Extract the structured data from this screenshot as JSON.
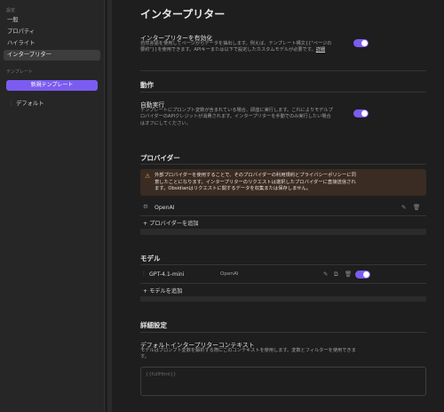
{
  "sidebar": {
    "settings_heading": "設定",
    "items": [
      {
        "label": "一般"
      },
      {
        "label": "プロパティ"
      },
      {
        "label": "ハイライト"
      },
      {
        "label": "インタープリター"
      }
    ],
    "templates_heading": "テンプレート",
    "new_template_label": "新規テンプレート",
    "template_items": [
      {
        "label": "デフォルト"
      }
    ]
  },
  "main": {
    "title": "インタープリター",
    "enable": {
      "name": "インタープリターを有効化",
      "desc_line1": "自然言語を使用してページからデータを抽出します。例えば、テンプレート構文{{\"ページの",
      "desc_line2": "要約\"}}を使用できます。APIキーまたは以下で設定したカスタムモデルが必要です。",
      "link": "詳細",
      "enabled": true
    },
    "behavior": {
      "title": "動作",
      "auto_run_name": "自動実行",
      "auto_run_desc_line1": "テンプレートにプロンプト変数が含まれている場合、即座に実行します。これによりモデルプ",
      "auto_run_desc_line2": "ロバイダーのAPIクレジットが消費されます。インタープリターを手動でのみ実行したい場合",
      "auto_run_desc_line3": "はオフにしてください。",
      "enabled": true
    },
    "providers": {
      "title": "プロバイダー",
      "warning_line1": "外部プロバイダーを使用することで、そのプロバイダーの利用規約とプライバシーポリシーに同",
      "warning_line2": "意したことになります。インタープリターのリクエストは選択したプロバイダーに直接送信され",
      "warning_line3": "ます。Obsidianはリクエストに関するデータを収集または保存しません。",
      "items": [
        {
          "name": "OpenAI"
        }
      ],
      "add_label": "+ プロバイダーを追加"
    },
    "models": {
      "title": "モデル",
      "items": [
        {
          "name": "GPT-4.1-mini",
          "provider": "OpenAI",
          "enabled": true
        }
      ],
      "add_label": "+ モデルを追加"
    },
    "advanced": {
      "title": "詳細設定",
      "context_name": "デフォルトインタープリターコンテキスト",
      "context_desc": "モデルはプロンプト変数を解析する際にこのコンテキストを使用します。変数とフィルターを使用できま",
      "context_desc2": "す。",
      "context_placeholder": "{{fullHtml}}"
    }
  },
  "colors": {
    "accent": "#7b5cf0",
    "background": "#1e1e1e",
    "sidebar": "#262626",
    "warning_bg": "#3a2c22",
    "warning_icon": "#e8a45c"
  }
}
